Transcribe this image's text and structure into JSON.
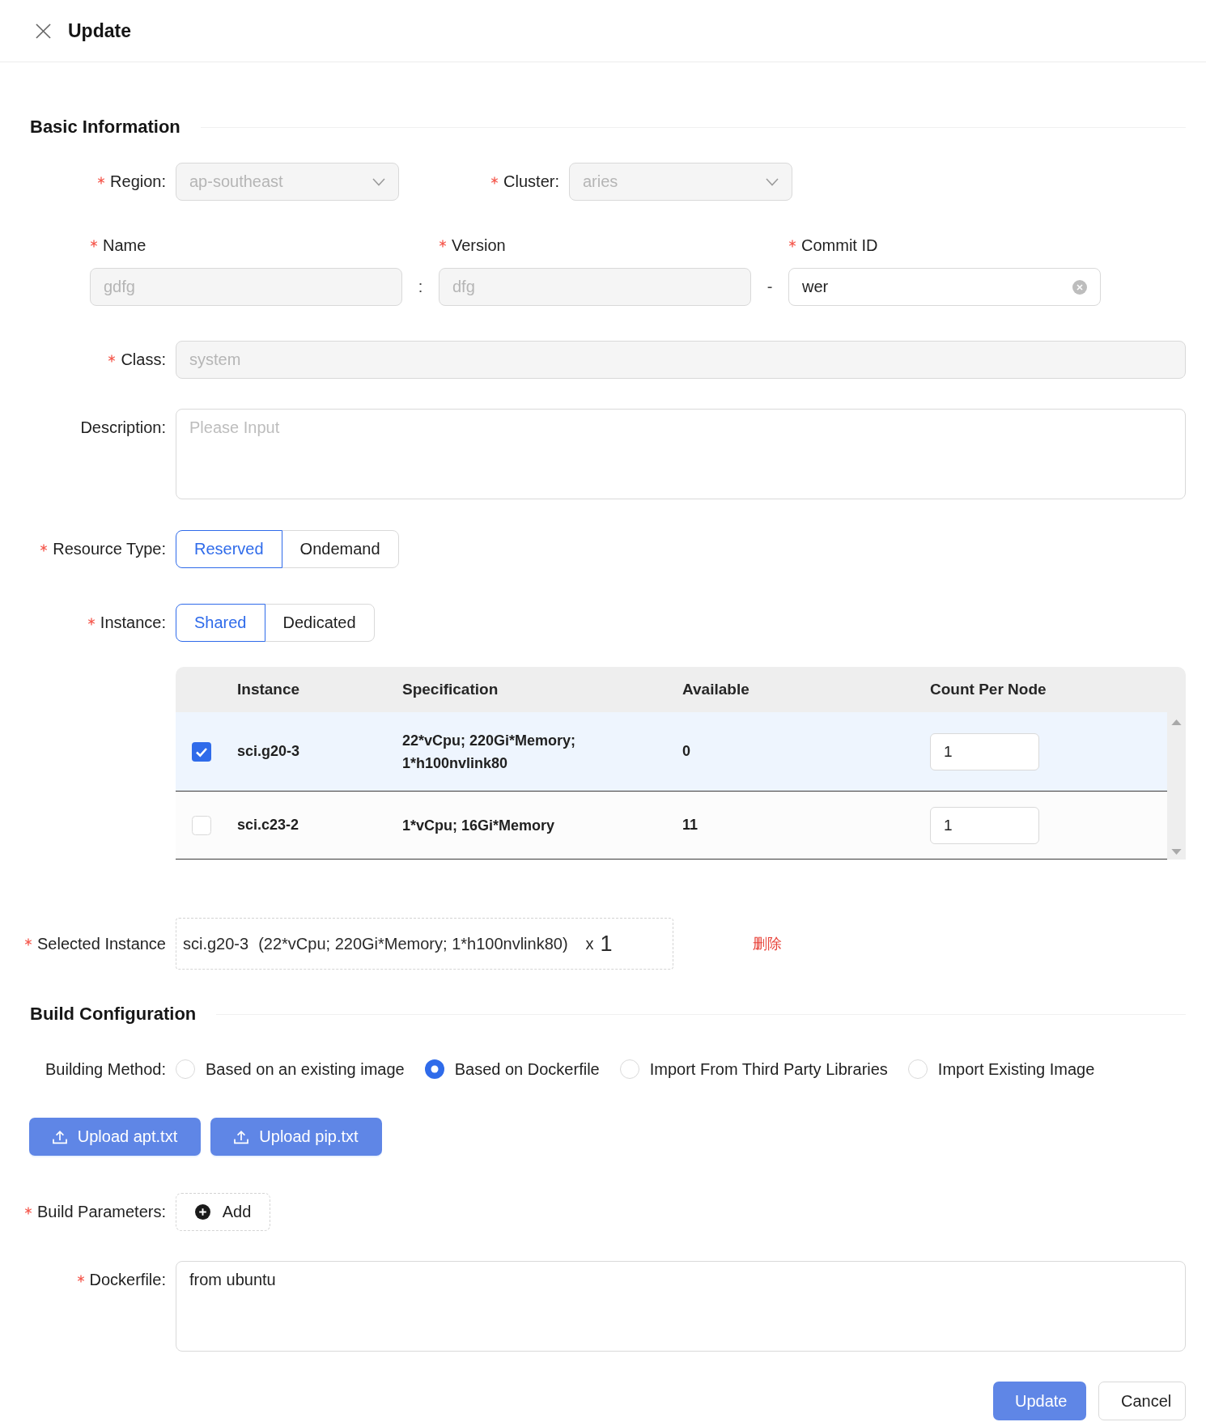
{
  "header": {
    "title": "Update"
  },
  "basic_information": {
    "title": "Basic Information",
    "region": {
      "label": "Region:",
      "required": true,
      "value": "ap-southeast",
      "disabled": true
    },
    "cluster": {
      "label": "Cluster:",
      "required": true,
      "value": "aries",
      "disabled": true
    },
    "name": {
      "label": "Name",
      "required": true,
      "value": "gdfg",
      "disabled": true
    },
    "name_version_separator": ":",
    "version": {
      "label": "Version",
      "required": true,
      "value": "dfg",
      "disabled": true
    },
    "version_commit_separator": "-",
    "commit_id": {
      "label": "Commit ID",
      "required": true,
      "value": "wer",
      "disabled": false
    },
    "class": {
      "label": "Class:",
      "required": true,
      "value": "system",
      "disabled": true
    },
    "description": {
      "label": "Description:",
      "placeholder": "Please Input"
    },
    "resource_type": {
      "label": "Resource Type:",
      "required": true,
      "options": [
        {
          "label": "Reserved",
          "selected": true
        },
        {
          "label": "Ondemand",
          "selected": false
        }
      ]
    },
    "instance": {
      "label": "Instance:",
      "required": true,
      "options": [
        {
          "label": "Shared",
          "selected": true
        },
        {
          "label": "Dedicated",
          "selected": false
        }
      ]
    },
    "instance_table": {
      "columns": [
        "Instance",
        "Specification",
        "Available",
        "Count Per Node"
      ],
      "rows": [
        {
          "checked": true,
          "instance": "sci.g20-3",
          "specification": "22*vCpu; 220Gi*Memory; 1*h100nvlink80",
          "available": "0",
          "count_per_node": "1"
        },
        {
          "checked": false,
          "instance": "sci.c23-2",
          "specification": "1*vCpu; 16Gi*Memory",
          "available": "11",
          "count_per_node": "1"
        }
      ]
    },
    "selected_instance": {
      "label": "Selected Instance",
      "required": true,
      "items": [
        {
          "instance": "sci.g20-3",
          "specification": "(22*vCpu; 220Gi*Memory; 1*h100nvlink80)",
          "multiplier": "x",
          "count": "1",
          "delete_link": "删除"
        }
      ]
    }
  },
  "build_configuration": {
    "title": "Build Configuration",
    "building_method": {
      "label": "Building Method:",
      "options": [
        {
          "label": "Based on an existing image",
          "selected": false
        },
        {
          "label": "Based on Dockerfile",
          "selected": true
        },
        {
          "label": "Import From Third Party Libraries",
          "selected": false
        },
        {
          "label": "Import Existing Image",
          "selected": false
        }
      ]
    },
    "upload_buttons": [
      {
        "label": "Upload apt.txt"
      },
      {
        "label": "Upload pip.txt"
      }
    ],
    "build_parameters": {
      "label": "Build Parameters:",
      "required": true,
      "add_button": "Add"
    },
    "dockerfile": {
      "label": "Dockerfile:",
      "required": true,
      "value": "from ubuntu"
    }
  },
  "footer": {
    "buttons": [
      {
        "label": "Update",
        "kind": "primary"
      },
      {
        "label": "Cancel",
        "kind": "default"
      }
    ]
  }
}
